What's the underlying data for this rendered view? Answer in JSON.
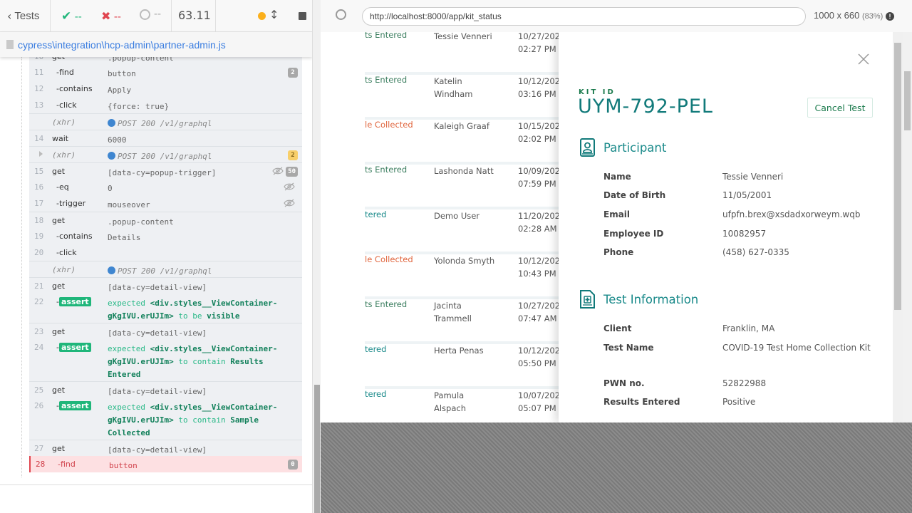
{
  "topbar": {
    "back_label": "Tests",
    "passed": "--",
    "failed": "--",
    "pending": "--",
    "duration": "63.11"
  },
  "spec_path": "cypress\\integration\\hcp-admin\\partner-admin.js",
  "commands": [
    {
      "num": "10",
      "name": "get",
      "child": false,
      "grp": true,
      "msg": [
        {
          "t": ".popup-content"
        }
      ]
    },
    {
      "num": "11",
      "name": "find",
      "child": true,
      "msg": [
        {
          "t": "button"
        }
      ],
      "badge": "2"
    },
    {
      "num": "12",
      "name": "contains",
      "child": true,
      "msg": [
        {
          "t": "Apply"
        }
      ]
    },
    {
      "num": "13",
      "name": "click",
      "child": true,
      "msg": [
        {
          "t": "{force: true}"
        }
      ]
    },
    {
      "xhr": true,
      "grp": true,
      "name": "(xhr)",
      "msg": [
        {
          "t": "POST 200 /v1/graphql"
        }
      ]
    },
    {
      "num": "14",
      "name": "wait",
      "child": false,
      "grp": true,
      "msg": [
        {
          "t": "6000"
        }
      ]
    },
    {
      "xhr": true,
      "grp": true,
      "caret": true,
      "name": "(xhr)",
      "msg": [
        {
          "t": "POST 200 /v1/graphql"
        }
      ],
      "badge": "2",
      "badge_color": "yellow"
    },
    {
      "num": "15",
      "name": "get",
      "child": false,
      "grp": true,
      "msg": [
        {
          "t": "[data-cy=popup-trigger]"
        }
      ],
      "badge": "50",
      "hidden": true
    },
    {
      "num": "16",
      "name": "eq",
      "child": true,
      "msg": [
        {
          "t": "0"
        }
      ],
      "hidden": true
    },
    {
      "num": "17",
      "name": "trigger",
      "child": true,
      "msg": [
        {
          "t": "mouseover"
        }
      ],
      "hidden": true
    },
    {
      "num": "18",
      "name": "get",
      "child": false,
      "grp": true,
      "msg": [
        {
          "t": ".popup-content"
        }
      ]
    },
    {
      "num": "19",
      "name": "contains",
      "child": true,
      "msg": [
        {
          "t": "Details"
        }
      ]
    },
    {
      "num": "20",
      "name": "click",
      "child": true,
      "msg": []
    },
    {
      "xhr": true,
      "grp": true,
      "name": "(xhr)",
      "msg": [
        {
          "t": "POST 200 /v1/graphql"
        }
      ]
    },
    {
      "num": "21",
      "name": "get",
      "child": false,
      "grp": true,
      "msg": [
        {
          "t": "[data-cy=detail-view]"
        }
      ]
    },
    {
      "num": "22",
      "name": "assert",
      "child": true,
      "assert": true,
      "lines": 2,
      "msg": [
        {
          "t": "expected"
        },
        {
          "t": "<div.styles__ViewContainer-gKgIVU.erUJIm>",
          "b": true
        },
        {
          "t": "to be"
        },
        {
          "t": "visible",
          "b": true
        }
      ]
    },
    {
      "num": "23",
      "name": "get",
      "child": false,
      "grp": true,
      "msg": [
        {
          "t": "[data-cy=detail-view]"
        }
      ]
    },
    {
      "num": "24",
      "name": "assert",
      "child": true,
      "assert": true,
      "lines": 3,
      "msg": [
        {
          "t": "expected"
        },
        {
          "t": "<div.styles__ViewContainer-gKgIVU.erUJIm>",
          "b": true
        },
        {
          "t": "to contain"
        },
        {
          "t": "Results Entered",
          "b": true
        }
      ]
    },
    {
      "num": "25",
      "name": "get",
      "child": false,
      "grp": true,
      "msg": [
        {
          "t": "[data-cy=detail-view]"
        }
      ]
    },
    {
      "num": "26",
      "name": "assert",
      "child": true,
      "assert": true,
      "lines": 3,
      "msg": [
        {
          "t": "expected"
        },
        {
          "t": "<div.styles__ViewContainer-gKgIVU.erUJIm>",
          "b": true
        },
        {
          "t": "to contain"
        },
        {
          "t": "Sample Collected",
          "b": true
        }
      ]
    },
    {
      "num": "27",
      "name": "get",
      "child": false,
      "grp": true,
      "msg": [
        {
          "t": "[data-cy=detail-view]"
        }
      ]
    },
    {
      "num": "28",
      "name": "find",
      "child": true,
      "fail": true,
      "msg": [
        {
          "t": "button"
        }
      ],
      "badge": "0"
    }
  ],
  "browser": {
    "url": "http://localhost:8000/app/kit_status",
    "viewport": "1000 x 660",
    "scale": "(83%)"
  },
  "table_rows": [
    {
      "status": "ts Entered",
      "status_color": "#3a7d5e",
      "name": "Tessie Venneri",
      "date": "10/27/202",
      "time": "02:27 PM"
    },
    {
      "status": "ts Entered",
      "status_color": "#3a7d5e",
      "name": "Katelin Windham",
      "date": "10/12/202",
      "time": "03:16 PM"
    },
    {
      "status": "le Collected",
      "status_color": "#e0643c",
      "name": "Kaleigh Graaf",
      "date": "10/15/202",
      "time": "02:02 PM"
    },
    {
      "status": "ts Entered",
      "status_color": "#3a7d5e",
      "name": "Lashonda Natt",
      "date": "10/09/202",
      "time": "07:59 PM"
    },
    {
      "status": "tered",
      "status_color": "#1a8a8a",
      "name": "Demo User",
      "date": "11/20/202",
      "time": "02:28 AM"
    },
    {
      "status": "le Collected",
      "status_color": "#e0643c",
      "name": "Yolonda Smyth",
      "date": "10/12/202",
      "time": "10:43 PM"
    },
    {
      "status": "ts Entered",
      "status_color": "#3a7d5e",
      "name": "Jacinta Trammell",
      "date": "10/27/202",
      "time": "07:47 AM"
    },
    {
      "status": "tered",
      "status_color": "#1a8a8a",
      "name": "Herta Penas",
      "date": "10/12/202",
      "time": "05:50 PM"
    },
    {
      "status": "tered",
      "status_color": "#1a8a8a",
      "name": "Pamula Alspach",
      "date": "10/07/202",
      "time": "05:07 PM"
    }
  ],
  "modal": {
    "kit_label": "KIT ID",
    "kit_id": "UYM-792-PEL",
    "cancel_label": "Cancel Test",
    "participant": {
      "title": "Participant",
      "fields": [
        {
          "label": "Name",
          "value": "Tessie Venneri"
        },
        {
          "label": "Date of Birth",
          "value": "11/05/2001"
        },
        {
          "label": "Email",
          "value": "ufpfn.brex@xsdadxorweym.wqb"
        },
        {
          "label": "Employee ID",
          "value": "10082957"
        },
        {
          "label": "Phone",
          "value": "(458) 627-0335"
        }
      ]
    },
    "test_info": {
      "title": "Test Information",
      "fields": [
        {
          "label": "Client",
          "value": "Franklin, MA"
        },
        {
          "label": "Test Name",
          "value": "COVID-19 Test Home Collection Kit"
        },
        {
          "label": "PWN no.",
          "value": "52822988"
        },
        {
          "label": "Results Entered",
          "value": "Positive"
        }
      ]
    }
  },
  "colors": {
    "accent": "#117a7a",
    "pass": "#1fb67a",
    "fail": "#e0454f",
    "link": "#3a7de0"
  }
}
